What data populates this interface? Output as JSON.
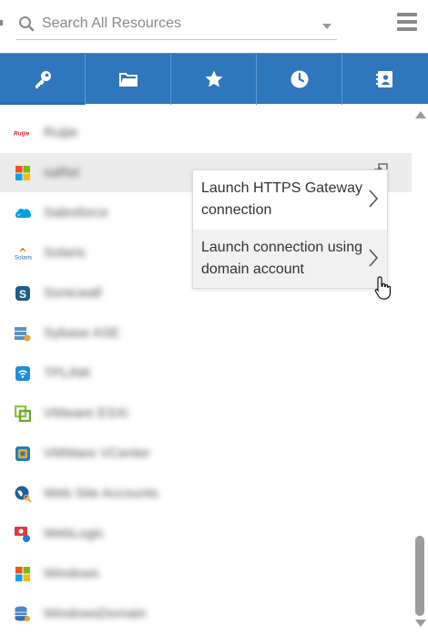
{
  "search": {
    "placeholder": "Search All Resources"
  },
  "tabs": [
    {
      "name": "key",
      "icon": "key-icon"
    },
    {
      "name": "folder",
      "icon": "folder-icon"
    },
    {
      "name": "favorites",
      "icon": "star-icon"
    },
    {
      "name": "recent",
      "icon": "clock-icon"
    },
    {
      "name": "contacts",
      "icon": "contact-card-icon"
    }
  ],
  "resources": [
    {
      "label": "Ruijie",
      "icon": "ruijie-logo-icon"
    },
    {
      "label": "saRet",
      "icon": "windows-logo-icon"
    },
    {
      "label": "Salesforce",
      "icon": "salesforce-logo-icon"
    },
    {
      "label": "Solaris",
      "icon": "solaris-logo-icon"
    },
    {
      "label": "Sonicwall",
      "icon": "sonicwall-logo-icon"
    },
    {
      "label": "Sybase ASE",
      "icon": "sybase-db-icon"
    },
    {
      "label": "TPLINK",
      "icon": "tplink-logo-icon"
    },
    {
      "label": "VMware ESXi",
      "icon": "vmware-logo-icon"
    },
    {
      "label": "VMWare VCenter",
      "icon": "vcenter-logo-icon"
    },
    {
      "label": "Web Site Accounts",
      "icon": "globe-key-icon"
    },
    {
      "label": "WebLogic",
      "icon": "weblogic-icon"
    },
    {
      "label": "Windows",
      "icon": "windows-logo-icon"
    },
    {
      "label": "WindowsDomain",
      "icon": "database-icon"
    }
  ],
  "context_menu": {
    "items": [
      {
        "label": "Launch HTTPS Gateway connection"
      },
      {
        "label": "Launch connection using domain account"
      }
    ]
  },
  "colors": {
    "tab_bar": "#2f77bd",
    "hover_row": "#ececec",
    "menu_hover": "#f1f1f1"
  }
}
